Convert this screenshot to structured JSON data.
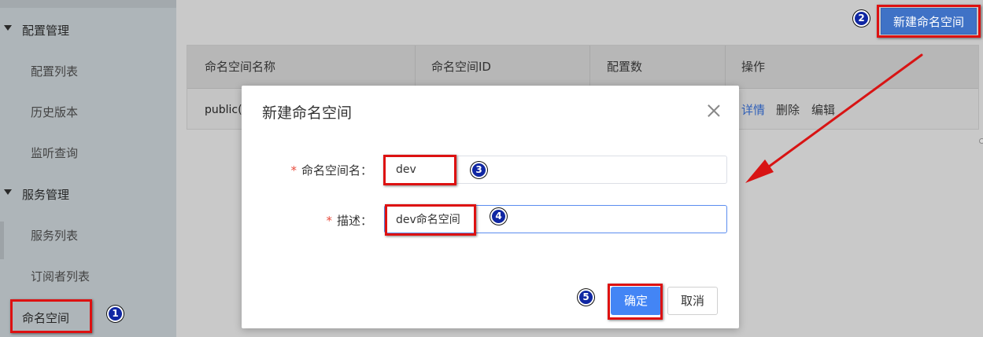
{
  "sidebar": {
    "groups": [
      {
        "label": "配置管理",
        "items": [
          "配置列表",
          "历史版本",
          "监听查询"
        ]
      },
      {
        "label": "服务管理",
        "items": [
          "服务列表",
          "订阅者列表"
        ]
      }
    ],
    "namespace_item": "命名空间"
  },
  "toolbar": {
    "new_namespace_button": "新建命名空间"
  },
  "table": {
    "columns": [
      "命名空间名称",
      "命名空间ID",
      "配置数",
      "操作"
    ],
    "rows": [
      {
        "name": "public(",
        "actions": [
          "详情",
          "删除",
          "编辑"
        ]
      }
    ]
  },
  "modal": {
    "title": "新建命名空间",
    "fields": [
      {
        "required_mark": "*",
        "label": "命名空间名：",
        "value": "dev"
      },
      {
        "required_mark": "*",
        "label": "描述：",
        "value": "dev命名空间"
      }
    ],
    "confirm_button": "确定",
    "cancel_button": "取消"
  },
  "annotations": {
    "steps": [
      "1",
      "2",
      "3",
      "4",
      "5"
    ],
    "highlight_color": "#dd1111",
    "step_badge_color": "#1027a3"
  },
  "colors": {
    "primary": "#4385f5",
    "link": "#2f5fb8",
    "required": "#e84c3d"
  }
}
